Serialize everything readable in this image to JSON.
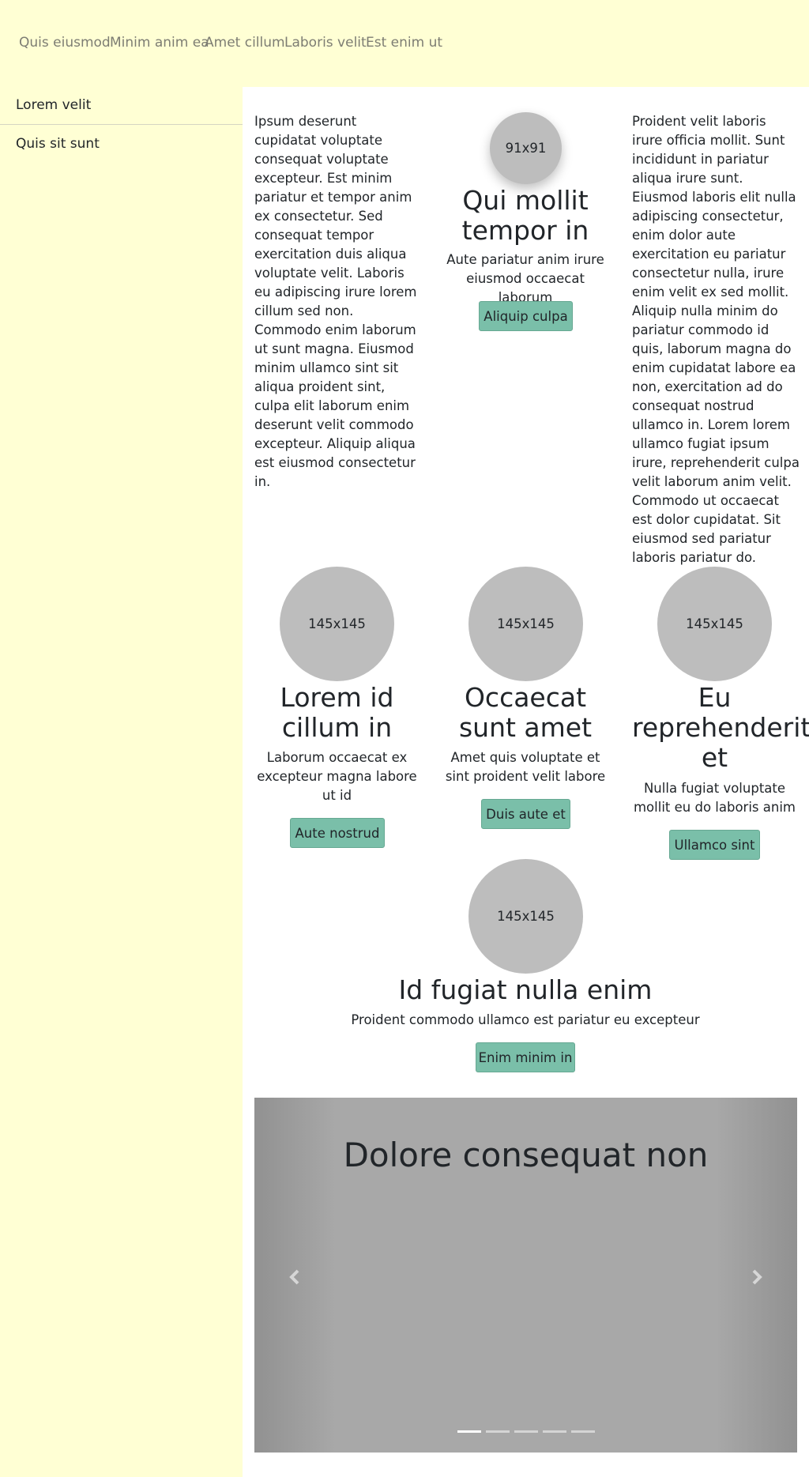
{
  "nav": {
    "items": [
      "Quis eiusmod",
      "Minim anim ea",
      "Amet cillum",
      "Laboris velit",
      "Est enim ut"
    ]
  },
  "sidebar": {
    "items": [
      "Lorem velit",
      "Quis sit sunt"
    ]
  },
  "columns": {
    "left_text": "Ipsum deserunt cupidatat voluptate consequat voluptate excepteur. Est minim pariatur et tempor anim ex consectetur. Sed consequat tempor exercitation duis aliqua voluptate velit. Laboris eu adipiscing irure lorem cillum sed non. Commodo enim laborum ut sunt magna. Eiusmod minim ullamco sint sit aliqua proident sint, culpa elit laborum enim deserunt velit commodo excepteur. Aliquip aliqua est eiusmod consectetur in.",
    "center": {
      "image_label": "91x91",
      "title": "Qui mollit tempor in",
      "text": "Aute pariatur anim irure eiusmod occaecat laborum",
      "button": "Aliquip culpa"
    },
    "right_text": "Proident velit laboris irure officia mollit. Sunt incididunt in pariatur aliqua irure sunt. Eiusmod laboris elit nulla adipiscing consectetur, enim dolor aute exercitation eu pariatur consectetur nulla, irure enim velit ex sed mollit. Aliquip nulla minim do pariatur commodo id quis, laborum magna do enim cupidatat labore ea non, exercitation ad do consequat nostrud ullamco in. Lorem lorem ullamco fugiat ipsum irure, reprehenderit culpa velit laborum anim velit. Commodo ut occaecat est dolor cupidatat. Sit eiusmod sed pariatur laboris pariatur do."
  },
  "cards": [
    {
      "image_label": "145x145",
      "title": "Lorem id cillum in",
      "text": "Laborum occaecat ex excepteur magna labore ut id",
      "button": "Aute nostrud"
    },
    {
      "image_label": "145x145",
      "title": "Occaecat sunt amet",
      "text": "Amet quis voluptate et sint proident velit labore",
      "button": "Duis aute et"
    },
    {
      "image_label": "145x145",
      "title": "Eu reprehenderit et",
      "text": "Nulla fugiat voluptate mollit eu do laboris anim",
      "button": "Ullamco sint"
    },
    {
      "image_label": "145x145",
      "title": "Id fugiat nulla enim",
      "text": "Proident commodo ullamco est pariatur eu excepteur",
      "button": "Enim minim in"
    }
  ],
  "carousel": {
    "title": "Dolore consequat non",
    "slide_count": 5,
    "active_index": 0,
    "prev_icon": "chevron-left-icon",
    "next_icon": "chevron-right-icon"
  },
  "colors": {
    "nav_background": "#ffffd4",
    "button_background": "#7abfa9",
    "placeholder_gray": "#bdbdbd"
  }
}
